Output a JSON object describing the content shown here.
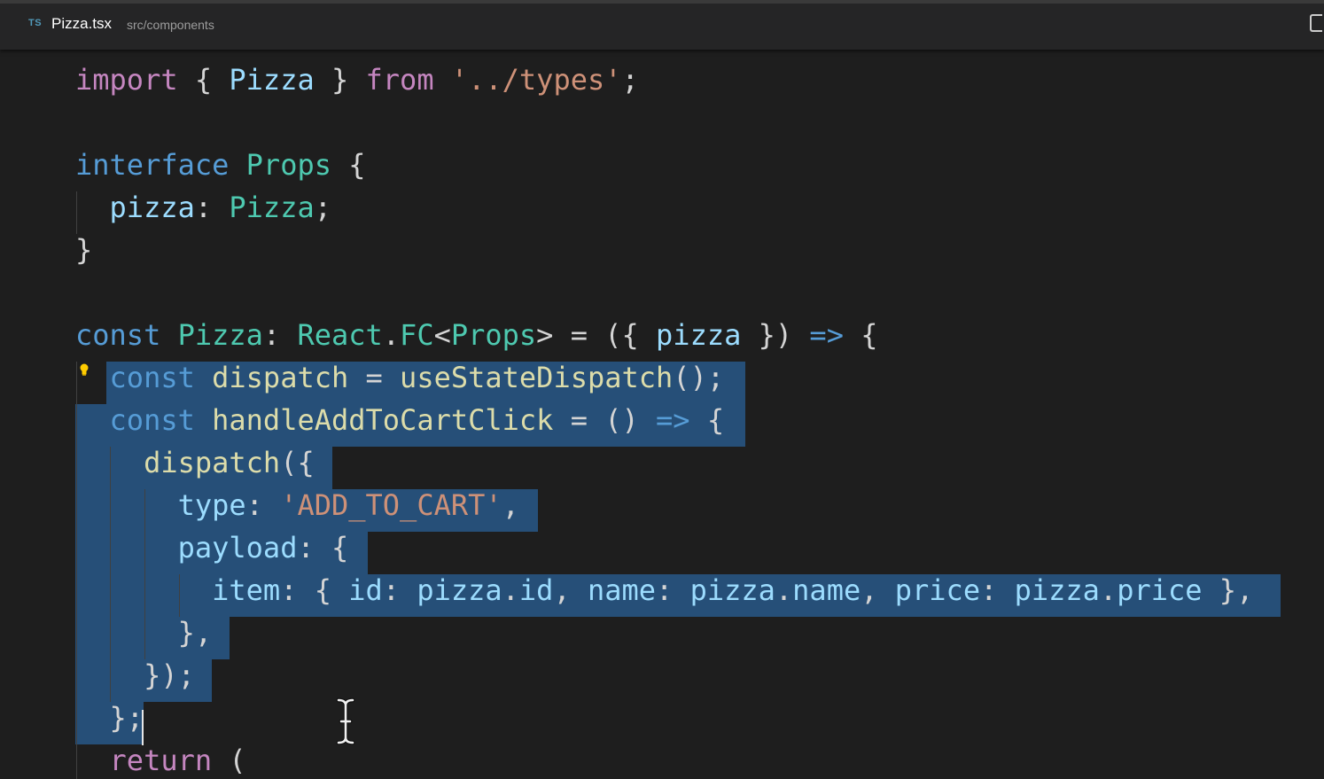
{
  "tab": {
    "language_badge": "TS",
    "file_name": "Pizza.tsx",
    "path": "src/components"
  },
  "colors": {
    "editor_background": "#1e1e1e",
    "selection": "#264f78",
    "keyword": "#569cd6",
    "control_keyword": "#c586c0",
    "type": "#4ec9b0",
    "variable": "#9cdcfe",
    "function": "#dcdcaa",
    "string": "#ce9178",
    "punctuation": "#d4d4d4"
  },
  "icons": {
    "file_type": "typescript-icon",
    "editor_action": "split-editor-icon",
    "hint": "lightbulb-icon",
    "mouse": "text-cursor-icon"
  },
  "code": {
    "lines": [
      [
        {
          "t": "import",
          "c": "kw2"
        },
        {
          "t": " { ",
          "c": "pu"
        },
        {
          "t": "Pizza",
          "c": "va"
        },
        {
          "t": " } ",
          "c": "pu"
        },
        {
          "t": "from",
          "c": "kw2"
        },
        {
          "t": " ",
          "c": "pu"
        },
        {
          "t": "'../types'",
          "c": "st"
        },
        {
          "t": ";",
          "c": "pu"
        }
      ],
      [],
      [
        {
          "t": "interface",
          "c": "kw"
        },
        {
          "t": " ",
          "c": "pu"
        },
        {
          "t": "Props",
          "c": "ty"
        },
        {
          "t": " {",
          "c": "pu"
        }
      ],
      [
        {
          "t": "  ",
          "c": "pu"
        },
        {
          "t": "pizza",
          "c": "va"
        },
        {
          "t": ": ",
          "c": "pu"
        },
        {
          "t": "Pizza",
          "c": "ty"
        },
        {
          "t": ";",
          "c": "pu"
        }
      ],
      [
        {
          "t": "}",
          "c": "pu"
        }
      ],
      [],
      [
        {
          "t": "const",
          "c": "kw"
        },
        {
          "t": " ",
          "c": "pu"
        },
        {
          "t": "Pizza",
          "c": "ty"
        },
        {
          "t": ": ",
          "c": "pu"
        },
        {
          "t": "React",
          "c": "ty"
        },
        {
          "t": ".",
          "c": "pu"
        },
        {
          "t": "FC",
          "c": "ty"
        },
        {
          "t": "<",
          "c": "pu"
        },
        {
          "t": "Props",
          "c": "ty"
        },
        {
          "t": "> = ({ ",
          "c": "pu"
        },
        {
          "t": "pizza",
          "c": "va"
        },
        {
          "t": " }) ",
          "c": "pu"
        },
        {
          "t": "=>",
          "c": "kw"
        },
        {
          "t": " {",
          "c": "pu"
        }
      ],
      [
        {
          "t": "  ",
          "c": "pu"
        },
        {
          "t": "const",
          "c": "kw"
        },
        {
          "t": " ",
          "c": "pu"
        },
        {
          "t": "dispatch",
          "c": "fn"
        },
        {
          "t": " = ",
          "c": "pu"
        },
        {
          "t": "useStateDispatch",
          "c": "fn"
        },
        {
          "t": "();",
          "c": "pu"
        }
      ],
      [
        {
          "t": "  ",
          "c": "pu"
        },
        {
          "t": "const",
          "c": "kw"
        },
        {
          "t": " ",
          "c": "pu"
        },
        {
          "t": "handleAddToCartClick",
          "c": "fn"
        },
        {
          "t": " = () ",
          "c": "pu"
        },
        {
          "t": "=>",
          "c": "kw"
        },
        {
          "t": " {",
          "c": "pu"
        }
      ],
      [
        {
          "t": "    ",
          "c": "pu"
        },
        {
          "t": "dispatch",
          "c": "fn"
        },
        {
          "t": "({",
          "c": "pu"
        }
      ],
      [
        {
          "t": "      ",
          "c": "pu"
        },
        {
          "t": "type",
          "c": "va"
        },
        {
          "t": ": ",
          "c": "pu"
        },
        {
          "t": "'ADD_TO_CART'",
          "c": "st"
        },
        {
          "t": ",",
          "c": "pu"
        }
      ],
      [
        {
          "t": "      ",
          "c": "pu"
        },
        {
          "t": "payload",
          "c": "va"
        },
        {
          "t": ": {",
          "c": "pu"
        }
      ],
      [
        {
          "t": "        ",
          "c": "pu"
        },
        {
          "t": "item",
          "c": "va"
        },
        {
          "t": ": { ",
          "c": "pu"
        },
        {
          "t": "id",
          "c": "va"
        },
        {
          "t": ": ",
          "c": "pu"
        },
        {
          "t": "pizza",
          "c": "va"
        },
        {
          "t": ".",
          "c": "pu"
        },
        {
          "t": "id",
          "c": "va"
        },
        {
          "t": ", ",
          "c": "pu"
        },
        {
          "t": "name",
          "c": "va"
        },
        {
          "t": ": ",
          "c": "pu"
        },
        {
          "t": "pizza",
          "c": "va"
        },
        {
          "t": ".",
          "c": "pu"
        },
        {
          "t": "name",
          "c": "va"
        },
        {
          "t": ", ",
          "c": "pu"
        },
        {
          "t": "price",
          "c": "va"
        },
        {
          "t": ": ",
          "c": "pu"
        },
        {
          "t": "pizza",
          "c": "va"
        },
        {
          "t": ".",
          "c": "pu"
        },
        {
          "t": "price",
          "c": "va"
        },
        {
          "t": " },",
          "c": "pu"
        }
      ],
      [
        {
          "t": "      },",
          "c": "pu"
        }
      ],
      [
        {
          "t": "    });",
          "c": "pu"
        }
      ],
      [
        {
          "t": "  };",
          "c": "pu"
        }
      ],
      [
        {
          "t": "  ",
          "c": "pu"
        },
        {
          "t": "return",
          "c": "kw2"
        },
        {
          "t": " (",
          "c": "pu"
        }
      ]
    ]
  }
}
